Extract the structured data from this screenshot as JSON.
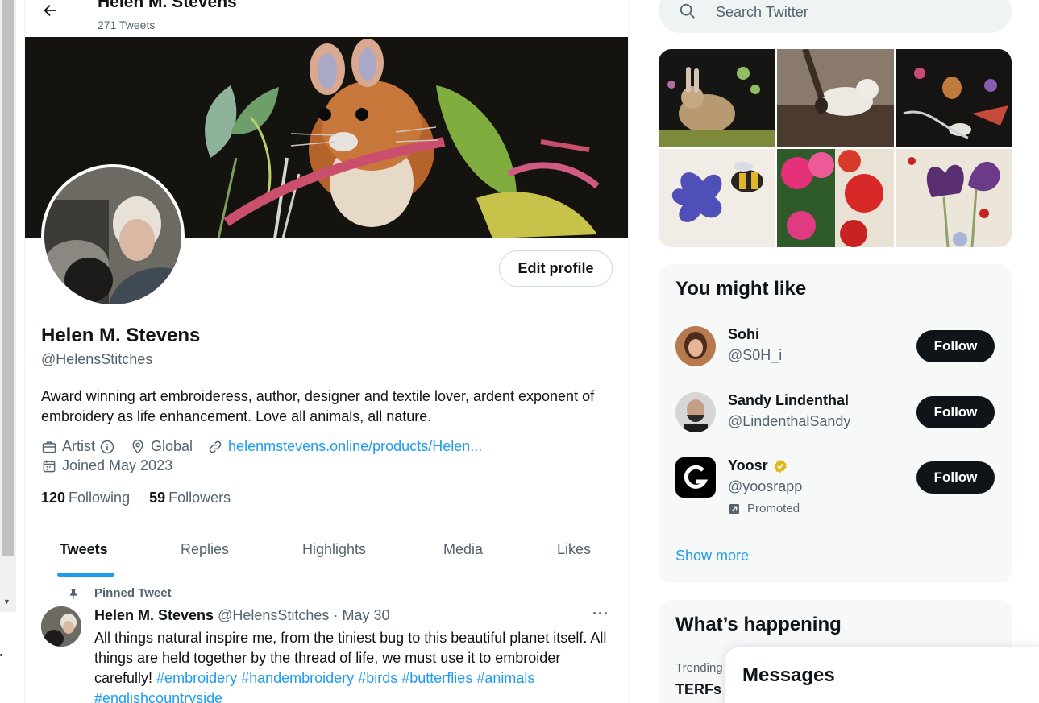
{
  "profile_header": {
    "title": "Helen M. Stevens",
    "tweet_count": "271 Tweets"
  },
  "profile": {
    "edit_label": "Edit profile",
    "name": "Helen M. Stevens",
    "handle": "@HelensStitches",
    "bio": "Award winning art embroideress, author, designer and textile lover, ardent exponent of embroidery as life enhancement.  Love all animals, all nature.",
    "category": "Artist",
    "location": "Global",
    "link": "helenmstevens.online/products/Helen...",
    "joined": "Joined May 2023",
    "following_count": "120",
    "following_label": "Following",
    "followers_count": "59",
    "followers_label": "Followers"
  },
  "tabs": [
    {
      "label": "Tweets",
      "active": true
    },
    {
      "label": "Replies",
      "active": false
    },
    {
      "label": "Highlights",
      "active": false
    },
    {
      "label": "Media",
      "active": false
    },
    {
      "label": "Likes",
      "active": false
    }
  ],
  "pinned_tweet": {
    "pinned_label": "Pinned Tweet",
    "author_name": "Helen M. Stevens",
    "author_handle": "@HelensStitches",
    "separator": "·",
    "date": "May 30",
    "more": "···",
    "text": "All things natural inspire me, from the tiniest bug to this beautiful planet itself.  All things are held together by the thread of life, we must use it to embroider carefully!",
    "hashtags": [
      "#embroidery",
      "#handembroidery",
      "#birds",
      "#butterflies",
      "#animals",
      "#englishcountryside"
    ]
  },
  "search": {
    "placeholder": "Search Twitter"
  },
  "you_might_like": {
    "title": "You might like",
    "follow_label": "Follow",
    "accounts": [
      {
        "name": "Sohi",
        "handle": "@S0H_i",
        "verified": false,
        "promoted": false
      },
      {
        "name": "Sandy Lindenthal",
        "handle": "@LindenthalSandy",
        "verified": false,
        "promoted": false
      },
      {
        "name": "Yoosr",
        "handle": "@yoosrapp",
        "verified": true,
        "promoted": true
      }
    ],
    "promoted_label": "Promoted",
    "show_more": "Show more"
  },
  "whats_happening": {
    "title": "What’s happening",
    "trend_label": "Trending",
    "trend_name": "TERFs"
  },
  "messages": {
    "title": "Messages"
  },
  "colors": {
    "accent": "#1d9bf0",
    "text_primary": "#0f1419",
    "text_secondary": "#536471",
    "panel_bg": "#f7f9f9",
    "verified_gold": "#e2b719"
  }
}
